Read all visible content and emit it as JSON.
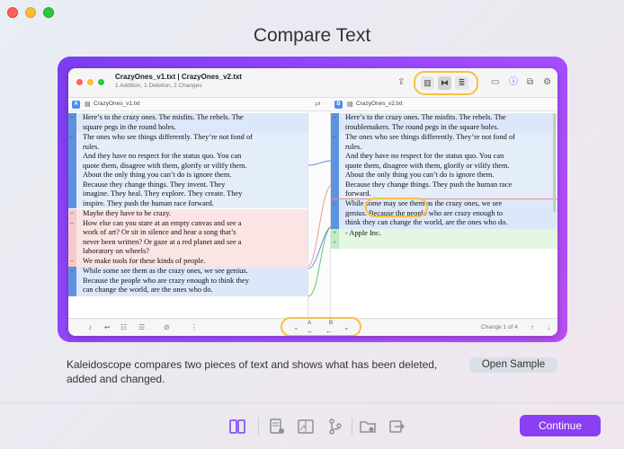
{
  "page": {
    "title": "Compare Text"
  },
  "window": {
    "title": "CrazyOnes_v1.txt | CrazyOnes_v2.txt",
    "subtitle": "1 Addition, 1 Deletion, 2 Changes"
  },
  "files": {
    "left": {
      "badge": "A",
      "name": "CrazyOnes_v1.txt"
    },
    "right": {
      "badge": "B",
      "name": "CrazyOnes_v2.txt"
    }
  },
  "left_lines": {
    "b1": [
      "Here’s to the crazy ones. The misfits. The rebels. The",
      "square pegs in the round holes."
    ],
    "b2": [
      "The ones who see things differently. They’re not fond of",
      "rules.",
      "And they have no respect for the status quo. You can",
      "quote them, disagree with them, glorify or vilify them.",
      "About the only thing you can’t do is ignore them.",
      "Because they change things. They invent. They",
      "imagine. They heal. They explore. They create. They",
      "inspire. They push the human race forward."
    ],
    "b3": [
      "Maybe they have to be crazy.",
      "How else can you stare at an empty canvas and see a",
      "work of art? Or sit in silence and hear a song that’s",
      "never been written? Or gaze at a red planet and see a",
      "laboratory on wheels?",
      "We make tools for these kinds of people."
    ],
    "b4": [
      "While some see them as the crazy ones, we see genius.",
      "Because the people who are crazy enough to think they",
      "can change the world, are the ones who do."
    ]
  },
  "right_lines": {
    "b1": [
      "Here’s to the crazy ones. The misfits. The rebels. The",
      "troublemakers. The round pegs in the square holes."
    ],
    "b2": [
      "The ones who see things differently. They’re not fond of",
      "rules.",
      "And they have no respect for the status quo. You can",
      "quote them, disagree with them, glorify or vilify them.",
      "About the only thing you can’t do is ignore them.",
      "Because they change things. They push the human race",
      "forward."
    ],
    "b4": [
      "While some may see them as the crazy ones, we see",
      "genius. Because the people who are crazy enough to",
      "think they can change the world, are the ones who do."
    ],
    "b5": [
      "",
      "- Apple Inc."
    ]
  },
  "bottom": {
    "change_counter": "Change 1 of 4",
    "nav_a": "A",
    "nav_b": "B"
  },
  "description": "Kaleidoscope compares two pieces of text and shows what has been deleted, added and changed.",
  "open_sample_label": "Open Sample",
  "continue_label": "Continue",
  "colors": {
    "accent": "#8a3ff2",
    "highlight_ring": "#f5c242",
    "change": "#5d92dd",
    "deletion": "#fbe4e4",
    "addition": "#e3f7e2"
  }
}
